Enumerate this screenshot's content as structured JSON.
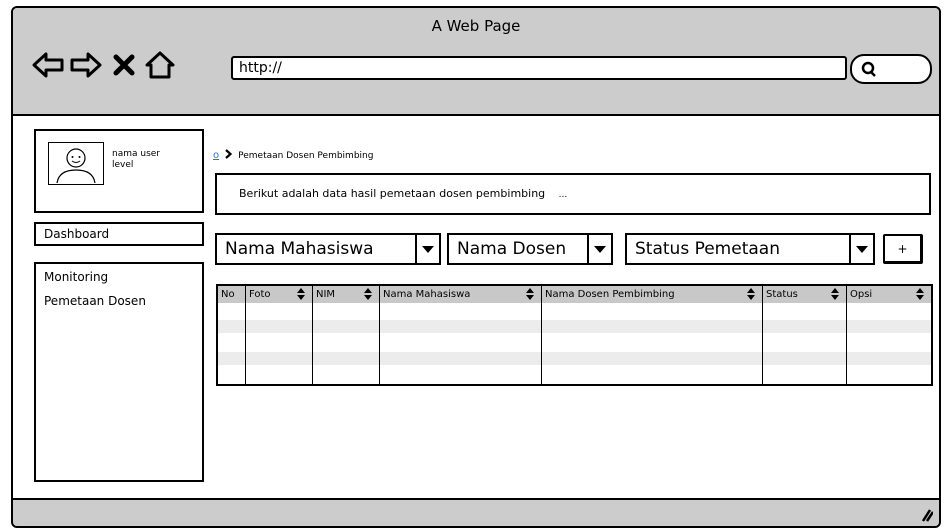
{
  "window": {
    "title": "A Web Page"
  },
  "browser": {
    "url": "http://"
  },
  "sidebar": {
    "user_name": "nama user",
    "user_level": "level",
    "dashboard": "Dashboard",
    "menu_items": [
      "Monitoring",
      "Pemetaan Dosen"
    ]
  },
  "breadcrumb": {
    "home": "o",
    "current": "Pemetaan Dosen Pembimbing"
  },
  "info": {
    "text": "Berikut adalah data hasil pemetaan dosen pembimbing",
    "ellipsis": "..."
  },
  "filters": {
    "mahasiswa": "Nama Mahasiswa",
    "dosen": "Nama Dosen",
    "status": "Status Pemetaan",
    "add_label": "+"
  },
  "table": {
    "columns": [
      "No",
      "Foto",
      "NIM",
      "Nama Mahasiswa",
      "Nama Dosen Pembimbing",
      "Status",
      "Opsi"
    ]
  }
}
